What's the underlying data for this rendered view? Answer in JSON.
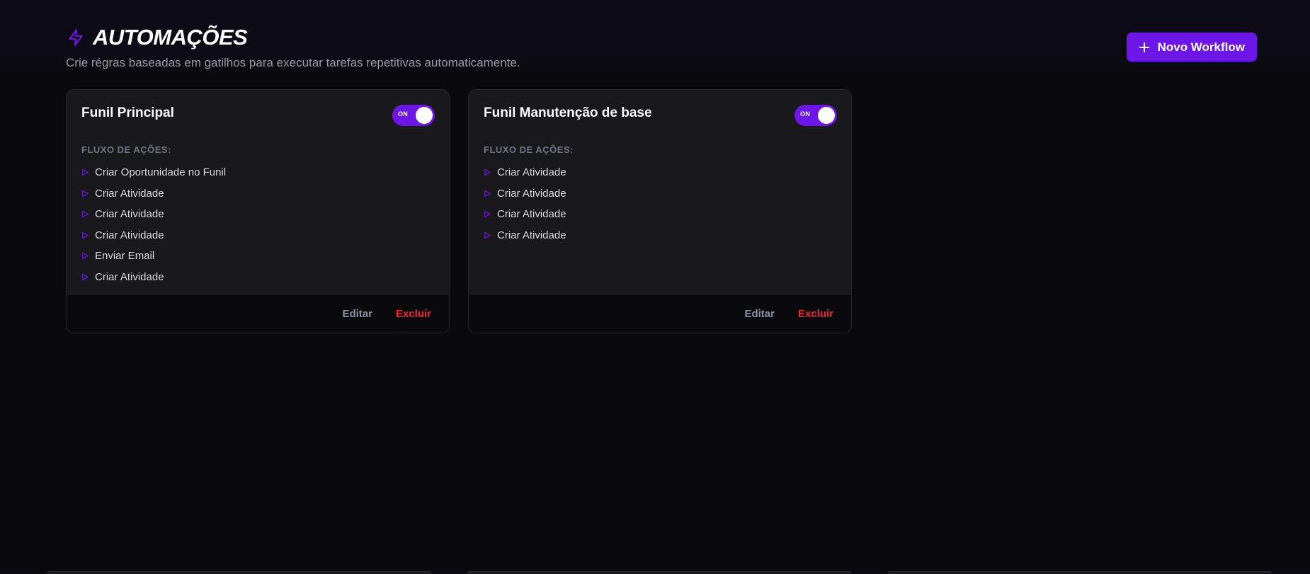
{
  "header": {
    "title": "AUTOMAÇÕES",
    "title_icon": "lightning-icon",
    "subtitle": "Crie régras baseadas em gatilhos para executar tarefas repetitivas automaticamente.",
    "new_button_label": "Novo Workflow"
  },
  "section_label": "FLUXO DE AÇÕES:",
  "workflows": [
    {
      "name": "Funil Principal",
      "toggle_label": "ON",
      "actions": [
        "Criar Oportunidade no Funil",
        "Criar Atividade",
        "Criar Atividade",
        "Criar Atividade",
        "Enviar Email",
        "Criar Atividade"
      ],
      "edit_label": "Editar",
      "delete_label": "Excluir"
    },
    {
      "name": "Funil Manutenção de base",
      "toggle_label": "ON",
      "actions": [
        "Criar Atividade",
        "Criar Atividade",
        "Criar Atividade",
        "Criar Atividade"
      ],
      "edit_label": "Editar",
      "delete_label": "Excluir"
    }
  ],
  "colors": {
    "accent": "#6d16e8",
    "danger": "#ef2b3a",
    "muted": "#8a93a6",
    "background": "#09090b",
    "card": "#19191c"
  }
}
